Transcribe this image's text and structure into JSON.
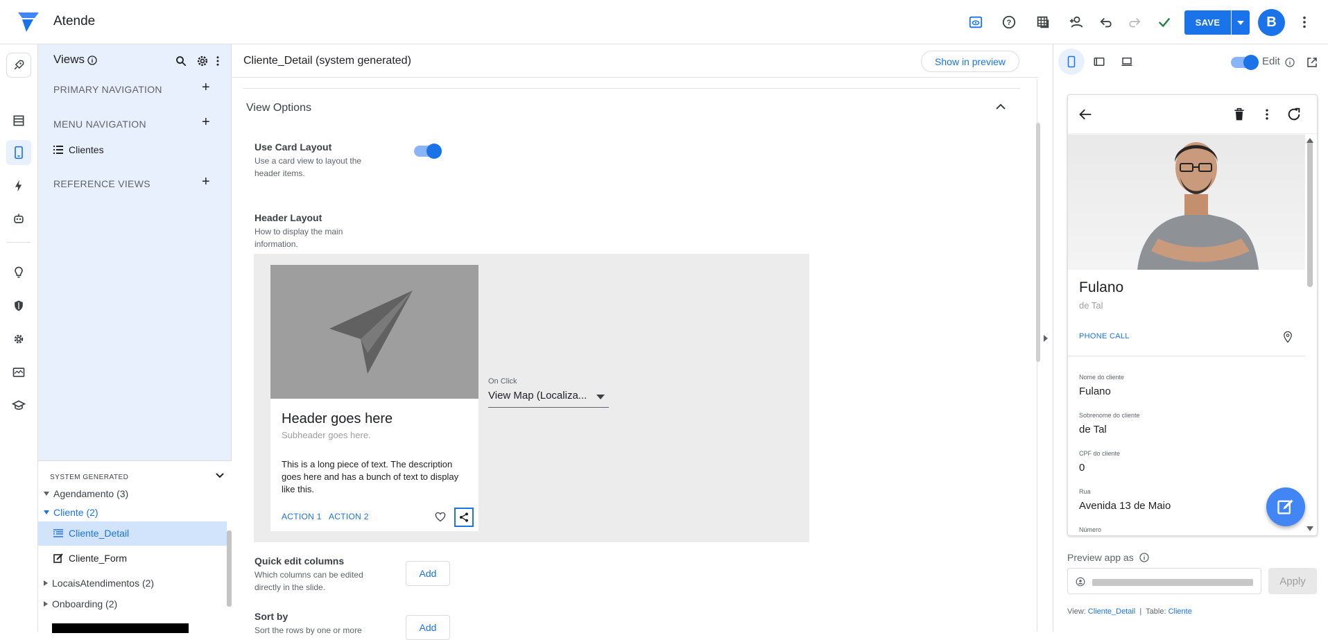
{
  "app": {
    "title": "Atende",
    "save_label": "SAVE",
    "avatar_initial": "B"
  },
  "colors": {
    "accent": "#1a73e8",
    "sidebar_bg": "#e8f0fe",
    "success": "#188038"
  },
  "toolbar_icons": [
    "preview-eye-icon",
    "help-icon",
    "table-icon",
    "add-user-icon",
    "undo-icon",
    "redo-icon",
    "check-icon",
    "more-vert-icon"
  ],
  "rail_icons": [
    "rocket-icon",
    "data-icon",
    "views-phone-icon",
    "automation-bolt-icon",
    "bot-icon",
    "idea-bulb-icon",
    "security-shield-icon",
    "settings-gear-icon",
    "monitor-icon",
    "learn-cap-icon"
  ],
  "views_panel": {
    "title": "Views",
    "primary_navigation": "PRIMARY NAVIGATION",
    "menu_navigation": "MENU NAVIGATION",
    "menu_item": "Clientes",
    "reference_views": "REFERENCE VIEWS",
    "system_generated": {
      "title": "SYSTEM GENERATED",
      "groups": [
        {
          "label": "Agendamento (3)"
        },
        {
          "label": "Cliente (2)"
        },
        {
          "label": "LocaisAtendimentos (2)"
        },
        {
          "label": "Onboarding (2)"
        }
      ],
      "cliente_children": [
        "Cliente_Detail",
        "Cliente_Form"
      ]
    }
  },
  "main": {
    "title": "Cliente_Detail (system generated)",
    "show_in_preview": "Show in preview",
    "section_title": "View Options",
    "use_card_layout": {
      "label": "Use Card Layout",
      "desc": "Use a card view to layout the header items.",
      "enabled": true
    },
    "header_layout": {
      "label": "Header Layout",
      "desc": "How to display the main information."
    },
    "card": {
      "header": "Header goes here",
      "subheader": "Subheader goes here.",
      "body": "This is a long piece of text. The description goes here and has a bunch of text to display like this.",
      "action1": "ACTION 1",
      "action2": "ACTION 2"
    },
    "on_click": {
      "label": "On Click",
      "value": "View Map (Localiza..."
    },
    "quick_edit": {
      "label": "Quick edit columns",
      "desc": "Which columns can be edited directly in the slide.",
      "button": "Add"
    },
    "sort_by": {
      "label": "Sort by",
      "desc": "Sort the rows by one or more",
      "button": "Add"
    }
  },
  "preview": {
    "edit_label": "Edit",
    "record": {
      "name": "Fulano",
      "subname": "de Tal",
      "phone_call": "PHONE CALL",
      "fields": [
        {
          "label": "Nome do cliente",
          "value": "Fulano"
        },
        {
          "label": "Sobrenome do cliente",
          "value": "de Tal"
        },
        {
          "label": "CPF do cliente",
          "value": "0"
        },
        {
          "label": "Rua",
          "value": "Avenida 13 de Maio"
        },
        {
          "label": "Número",
          "value": ""
        }
      ]
    },
    "preview_as": "Preview app as",
    "apply": "Apply",
    "footer": {
      "view_label": "View:",
      "view": "Cliente_Detail",
      "sep": "|",
      "table_label": "Table:",
      "table": "Cliente"
    }
  }
}
